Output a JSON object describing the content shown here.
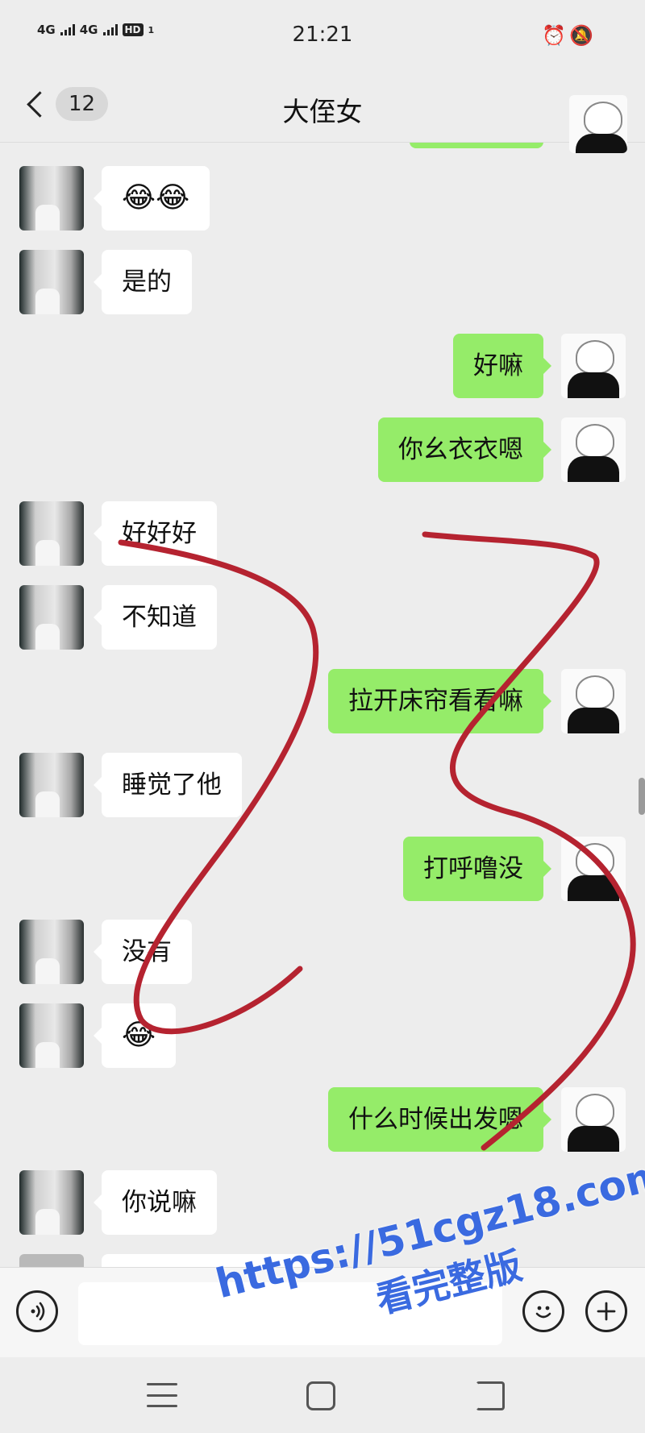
{
  "status_bar": {
    "network_1": "4G",
    "network_2": "4G",
    "hd": "HD",
    "sim_index": "1",
    "time": "21:21"
  },
  "header": {
    "title": "大侄女",
    "unread_badge": "12"
  },
  "messages": [
    {
      "side": "in",
      "text": "😂😂"
    },
    {
      "side": "in",
      "text": "是的"
    },
    {
      "side": "out",
      "text": "好嘛"
    },
    {
      "side": "out",
      "text": "你幺衣衣嗯"
    },
    {
      "side": "in",
      "text": "好好好"
    },
    {
      "side": "in",
      "text": "不知道"
    },
    {
      "side": "out",
      "text": "拉开床帘看看嘛"
    },
    {
      "side": "in",
      "text": "睡觉了他"
    },
    {
      "side": "out",
      "text": "打呼噜没"
    },
    {
      "side": "in",
      "text": "没有"
    },
    {
      "side": "in",
      "text": "😂"
    },
    {
      "side": "out",
      "text": "什么时候出发嗯"
    },
    {
      "side": "in",
      "text": "你说嘛"
    }
  ],
  "input": {
    "value": "",
    "voice_icon": "voice-icon",
    "emoji_icon": "emoji-icon",
    "plus_icon": "plus-icon"
  },
  "watermark": {
    "line1": "https://51cgz18.com",
    "line2": "看完整版"
  },
  "colors": {
    "background": "#ededed",
    "outgoing_bubble": "#95ec69",
    "incoming_bubble": "#ffffff",
    "scribble": "#b52330",
    "watermark": "#3a6ae0"
  }
}
